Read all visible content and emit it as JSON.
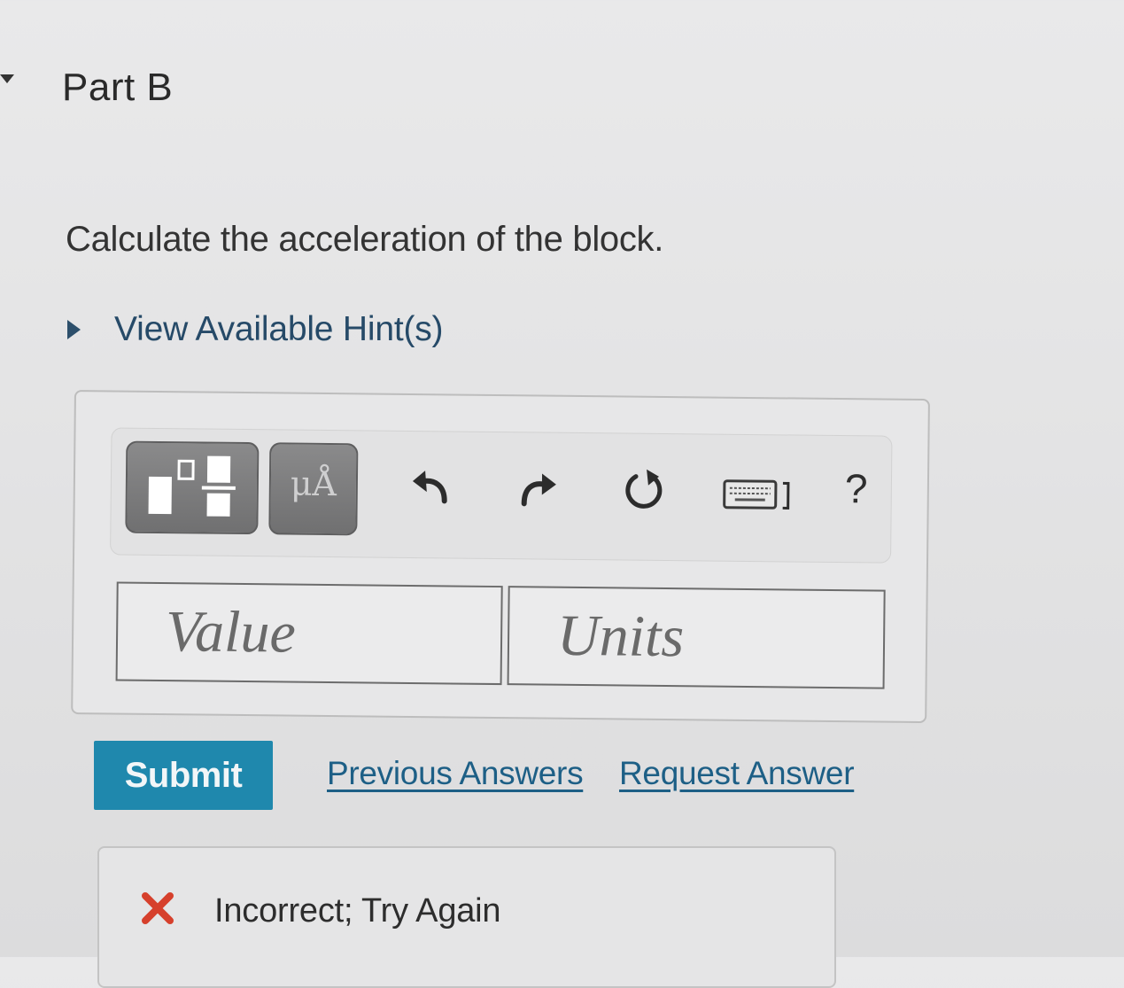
{
  "part": {
    "title": "Part B",
    "question": "Calculate the acceleration of the block."
  },
  "hints": {
    "label": "View Available Hint(s)"
  },
  "toolbar": {
    "units_glyph": "μÅ",
    "help_label": "?",
    "icons": [
      "templates-icon",
      "units-icon",
      "undo-icon",
      "redo-icon",
      "reset-icon",
      "keyboard-icon",
      "help-icon"
    ]
  },
  "inputs": {
    "value_placeholder": "Value",
    "units_placeholder": "Units"
  },
  "actions": {
    "submit_label": "Submit",
    "previous_answers": "Previous Answers",
    "request_answer": "Request Answer"
  },
  "feedback": {
    "message": "Incorrect; Try Again",
    "status": "incorrect"
  },
  "colors": {
    "submit": "#1f88ad",
    "link": "#1d5f86",
    "hint": "#264a68",
    "incorrect": "#d6402c"
  }
}
